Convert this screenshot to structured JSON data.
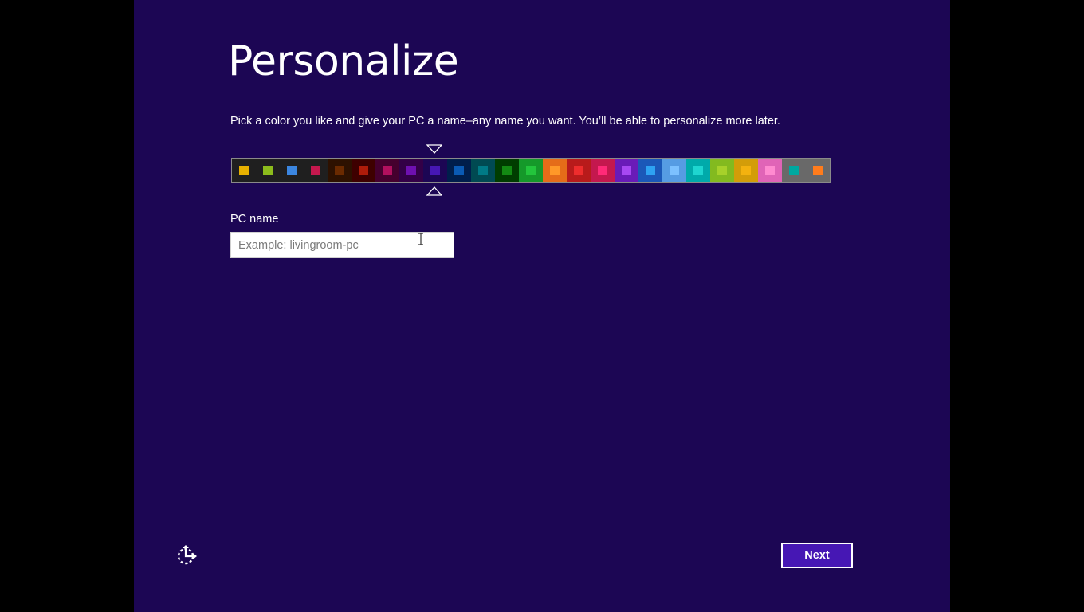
{
  "page": {
    "title": "Personalize",
    "subtitle": "Pick a color you like and give your PC a name–any name you want. You’ll be able to personalize more later."
  },
  "colors": {
    "background": "#1c0654",
    "outer_background": "#000000",
    "accent": "#4617b4"
  },
  "swatches": [
    {
      "bg": "#1f1f1f",
      "chip": "#e6b000"
    },
    {
      "bg": "#1f1f1f",
      "chip": "#8cbc1c"
    },
    {
      "bg": "#1f1f1f",
      "chip": "#3b86e0"
    },
    {
      "bg": "#1f1f1f",
      "chip": "#c4184e"
    },
    {
      "bg": "#2d1100",
      "chip": "#6a2a00"
    },
    {
      "bg": "#3e0000",
      "chip": "#b01c0a"
    },
    {
      "bg": "#45002e",
      "chip": "#b0105e"
    },
    {
      "bg": "#330047",
      "chip": "#6e10b0"
    },
    {
      "bg": "#1c0654",
      "chip": "#4617b4",
      "selected": true
    },
    {
      "bg": "#001e4c",
      "chip": "#0a5ab4"
    },
    {
      "bg": "#004a52",
      "chip": "#007a86"
    },
    {
      "bg": "#003d00",
      "chip": "#138a13"
    },
    {
      "bg": "#15992a",
      "chip": "#23c53c"
    },
    {
      "bg": "#e56c19",
      "chip": "#ff9828"
    },
    {
      "bg": "#b81b1b",
      "chip": "#ee2d2d"
    },
    {
      "bg": "#c4184e",
      "chip": "#ff2a78"
    },
    {
      "bg": "#691bb8",
      "chip": "#a748f2"
    },
    {
      "bg": "#1b58b8",
      "chip": "#2ea2f2"
    },
    {
      "bg": "#569ce3",
      "chip": "#7cc1ff"
    },
    {
      "bg": "#00aaaa",
      "chip": "#1ed6d0"
    },
    {
      "bg": "#83ba1f",
      "chip": "#a7d12a"
    },
    {
      "bg": "#d39d09",
      "chip": "#f3b20f"
    },
    {
      "bg": "#e064b7",
      "chip": "#ff8ad0"
    },
    {
      "bg": "#696969",
      "chip": "#00a8a0"
    },
    {
      "bg": "#696969",
      "chip": "#ff7c1c"
    }
  ],
  "pc_name": {
    "label": "PC name",
    "value": "",
    "placeholder": "Example: livingroom-pc"
  },
  "footer": {
    "next_label": "Next",
    "ease_of_access_icon": "ease-of-access-icon"
  }
}
